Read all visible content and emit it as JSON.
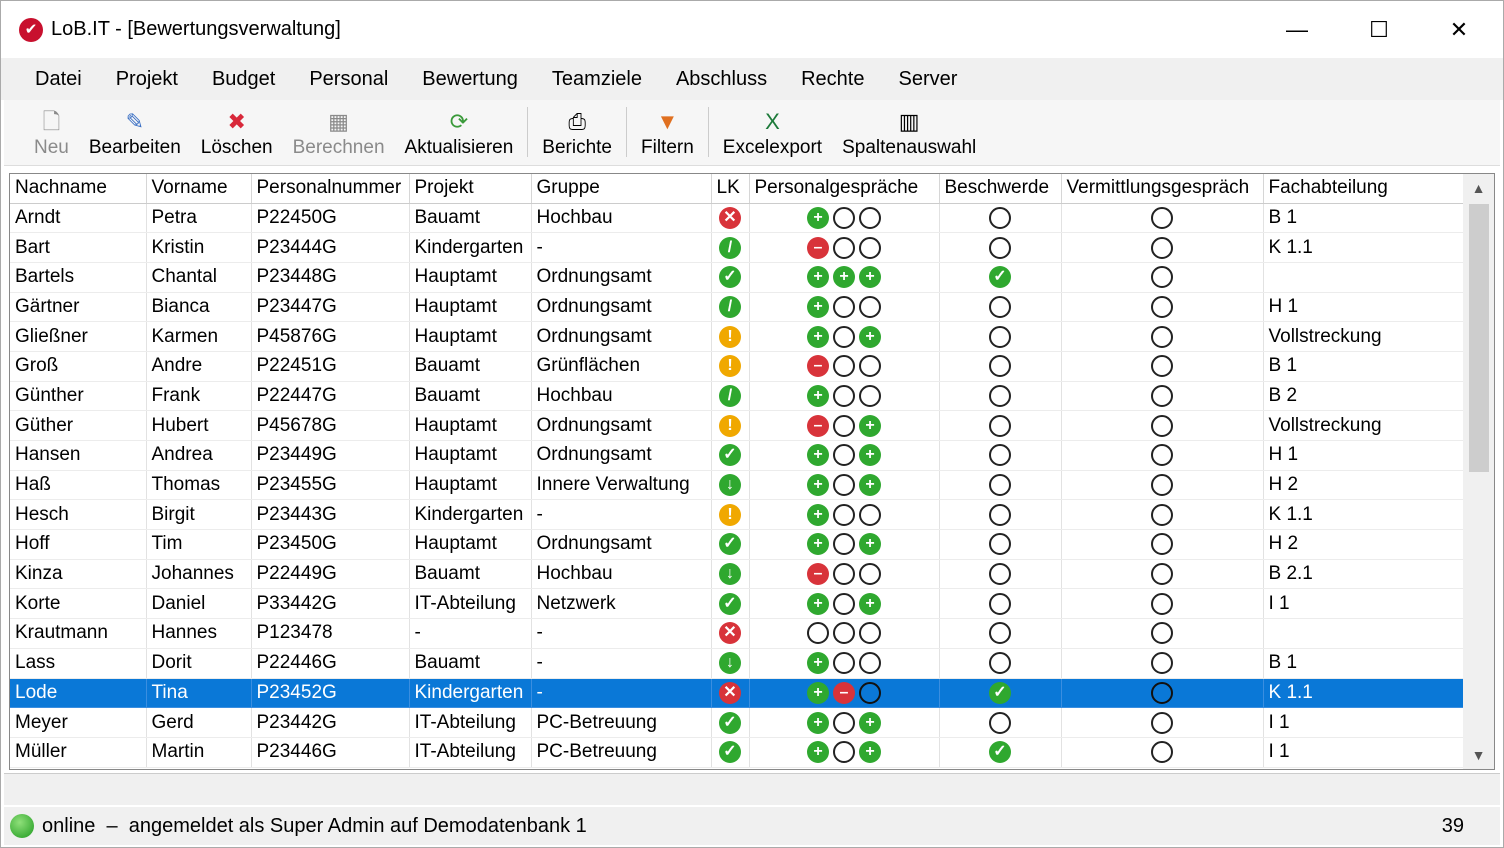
{
  "window": {
    "title": "LoB.IT - [Bewertungsverwaltung]"
  },
  "menu": [
    "Datei",
    "Projekt",
    "Budget",
    "Personal",
    "Bewertung",
    "Teamziele",
    "Abschluss",
    "Rechte",
    "Server"
  ],
  "toolbar": [
    {
      "label": "Neu",
      "icon": "new-document-icon",
      "disabled": true
    },
    {
      "label": "Bearbeiten",
      "icon": "edit-icon",
      "disabled": false
    },
    {
      "label": "Löschen",
      "icon": "delete-x-icon",
      "disabled": false
    },
    {
      "label": "Berechnen",
      "icon": "calculator-icon",
      "disabled": true
    },
    {
      "label": "Aktualisieren",
      "icon": "refresh-icon",
      "disabled": false
    },
    {
      "label": "Berichte",
      "icon": "printer-icon",
      "disabled": false
    },
    {
      "label": "Filtern",
      "icon": "filter-icon",
      "disabled": false
    },
    {
      "label": "Excelexport",
      "icon": "excel-icon",
      "disabled": false
    },
    {
      "label": "Spaltenauswahl",
      "icon": "columns-icon",
      "disabled": false
    }
  ],
  "table": {
    "columns": [
      "Nachname",
      "Vorname",
      "Personalnummer",
      "Projekt",
      "Gruppe",
      "LK",
      "Personalgespräche",
      "Beschwerde",
      "Vermittlungsgespräch",
      "Fachabteilung"
    ],
    "rows": [
      [
        "Arndt",
        "Petra",
        "P22450G",
        "Bauamt",
        "Hochbau",
        "x",
        "poo",
        "o",
        "o",
        "B 1"
      ],
      [
        "Bart",
        "Kristin",
        "P23444G",
        "Kindergarten",
        "-",
        "s",
        "moo",
        "o",
        "o",
        "K 1.1"
      ],
      [
        "Bartels",
        "Chantal",
        "P23448G",
        "Hauptamt",
        "Ordnungsamt",
        "c",
        "ppp",
        "c",
        "o",
        ""
      ],
      [
        "Gärtner",
        "Bianca",
        "P23447G",
        "Hauptamt",
        "Ordnungsamt",
        "s",
        "poo",
        "o",
        "o",
        "H 1"
      ],
      [
        "Gließner",
        "Karmen",
        "P45876G",
        "Hauptamt",
        "Ordnungsamt",
        "w",
        "pop",
        "o",
        "o",
        "Vollstreckung"
      ],
      [
        "Groß",
        "Andre",
        "P22451G",
        "Bauamt",
        "Grünflächen",
        "w",
        "moo",
        "o",
        "o",
        "B 1"
      ],
      [
        "Günther",
        "Frank",
        "P22447G",
        "Bauamt",
        "Hochbau",
        "s",
        "poo",
        "o",
        "o",
        "B 2"
      ],
      [
        "Güther",
        "Hubert",
        "P45678G",
        "Hauptamt",
        "Ordnungsamt",
        "w",
        "mop",
        "o",
        "o",
        "Vollstreckung"
      ],
      [
        "Hansen",
        "Andrea",
        "P23449G",
        "Hauptamt",
        "Ordnungsamt",
        "c",
        "pop",
        "o",
        "o",
        "H 1"
      ],
      [
        "Haß",
        "Thomas",
        "P23455G",
        "Hauptamt",
        "Innere Verwaltung",
        "d",
        "pop",
        "o",
        "o",
        "H 2"
      ],
      [
        "Hesch",
        "Birgit",
        "P23443G",
        "Kindergarten",
        "-",
        "w",
        "poo",
        "o",
        "o",
        "K 1.1"
      ],
      [
        "Hoff",
        "Tim",
        "P23450G",
        "Hauptamt",
        "Ordnungsamt",
        "c",
        "pop",
        "o",
        "o",
        "H 2"
      ],
      [
        "Kinza",
        "Johannes",
        "P22449G",
        "Bauamt",
        "Hochbau",
        "d",
        "moo",
        "o",
        "o",
        "B 2.1"
      ],
      [
        "Korte",
        "Daniel",
        "P33442G",
        "IT-Abteilung",
        "Netzwerk",
        "c",
        "pop",
        "o",
        "o",
        "I 1"
      ],
      [
        "Krautmann",
        "Hannes",
        "P123478",
        "-",
        "-",
        "x",
        "ooo",
        "o",
        "o",
        ""
      ],
      [
        "Lass",
        "Dorit",
        "P22446G",
        "Bauamt",
        "-",
        "d",
        "poo",
        "o",
        "o",
        "B 1"
      ],
      [
        "Lode",
        "Tina",
        "P23452G",
        "Kindergarten",
        "-",
        "x",
        "pmo",
        "c",
        "o",
        "K 1.1"
      ],
      [
        "Meyer",
        "Gerd",
        "P23442G",
        "IT-Abteilung",
        "PC-Betreuung",
        "c",
        "pop",
        "o",
        "o",
        "I 1"
      ],
      [
        "Müller",
        "Martin",
        "P23446G",
        "IT-Abteilung",
        "PC-Betreuung",
        "c",
        "pop",
        "c",
        "o",
        "I 1"
      ]
    ],
    "selected_row": 16
  },
  "status": {
    "text": "online  –  angemeldet als Super Admin auf Demodatenbank 1",
    "count": "39"
  }
}
